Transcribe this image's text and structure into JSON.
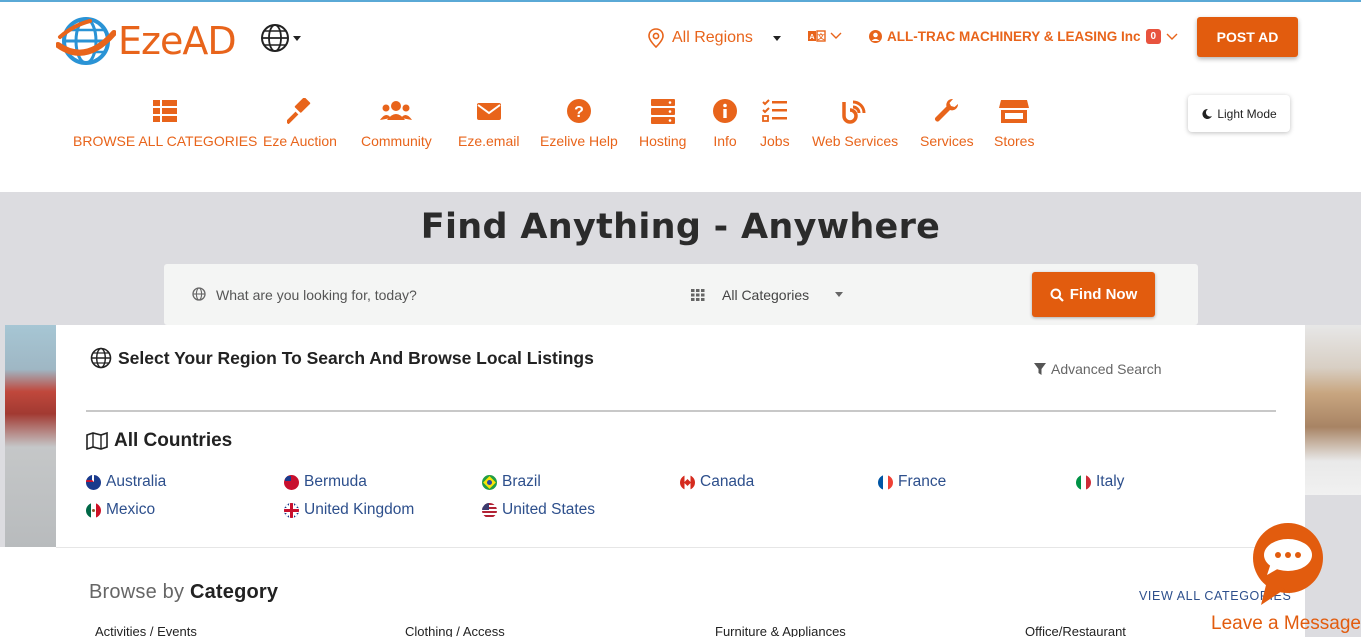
{
  "header": {
    "logo_text": "EzeAD",
    "region_label": "All Regions",
    "lang_icon": "translate-icon",
    "user_label": "ALL-TRAC MACHINERY & LEASING Inc",
    "notification_count": "0",
    "post_ad_label": "POST AD",
    "light_mode_label": "Light Mode"
  },
  "nav": {
    "items": [
      {
        "label": "BROWSE ALL CATEGORIES",
        "icon": "list-icon"
      },
      {
        "label": "Eze Auction",
        "icon": "gavel-icon"
      },
      {
        "label": "Community",
        "icon": "users-icon"
      },
      {
        "label": "Eze.email",
        "icon": "envelope-icon"
      },
      {
        "label": "Ezelive Help",
        "icon": "question-icon"
      },
      {
        "label": "Hosting",
        "icon": "server-icon"
      },
      {
        "label": "Info",
        "icon": "info-icon"
      },
      {
        "label": "Jobs",
        "icon": "tasks-icon"
      },
      {
        "label": "Web Services",
        "icon": "blog-icon"
      },
      {
        "label": "Services",
        "icon": "wrench-icon"
      },
      {
        "label": "Stores",
        "icon": "store-icon"
      }
    ]
  },
  "hero": {
    "title": "Find Anything - Anywhere",
    "search_placeholder": "What are you looking for, today?",
    "category_select": "All Categories",
    "find_button": "Find Now"
  },
  "region_panel": {
    "heading": "Select Your Region To Search And Browse Local Listings",
    "advanced_search": "Advanced Search",
    "countries_heading": "All Countries",
    "countries": [
      {
        "name": "Australia",
        "flag": "au"
      },
      {
        "name": "Bermuda",
        "flag": "bm"
      },
      {
        "name": "Brazil",
        "flag": "br"
      },
      {
        "name": "Canada",
        "flag": "ca"
      },
      {
        "name": "France",
        "flag": "fr"
      },
      {
        "name": "Italy",
        "flag": "it"
      },
      {
        "name": "Mexico",
        "flag": "mx"
      },
      {
        "name": "United Kingdom",
        "flag": "gb"
      },
      {
        "name": "United States",
        "flag": "us"
      }
    ]
  },
  "browse": {
    "title_prefix": "Browse by",
    "title_bold": "Category",
    "view_all": "VIEW ALL CATEGORIES",
    "columns": [
      "Activities / Events",
      "Clothing / Access",
      "Furniture & Appliances",
      "Office/Restaurant"
    ]
  },
  "chat": {
    "leave_message": "Leave a Message?"
  },
  "colors": {
    "brand_orange": "#e25c0e",
    "nav_orange": "#e8641b",
    "link_blue": "#2d4f8c",
    "hero_bg": "#dcdce0"
  }
}
